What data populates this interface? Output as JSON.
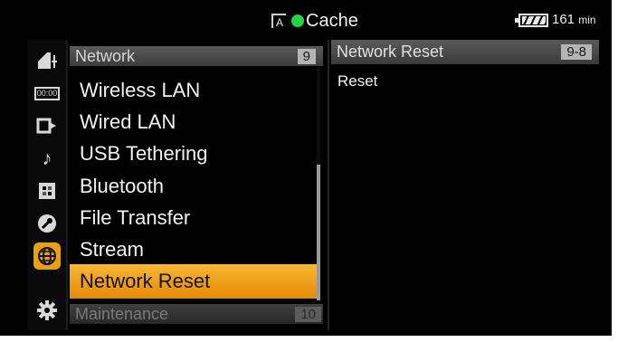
{
  "status_bar": {
    "media_icon_glyph": "A",
    "media_label": "Cache",
    "recording_dot_color": "#25d23f",
    "battery_icon": "battery-icon",
    "battery_level": 0.85,
    "battery_minutes": "161",
    "battery_unit": "min"
  },
  "category_icons": [
    {
      "name": "camera-icon",
      "glyph": "◢",
      "selected": false
    },
    {
      "name": "timecode-icon",
      "glyph": "00:00",
      "selected": false
    },
    {
      "name": "output-icon",
      "glyph": "⇥",
      "selected": false
    },
    {
      "name": "audio-icon",
      "glyph": "♪",
      "selected": false
    },
    {
      "name": "thumbnail-icon",
      "glyph": "▦",
      "selected": false
    },
    {
      "name": "tool-icon",
      "glyph": "⚙",
      "selected": false
    },
    {
      "name": "network-icon",
      "glyph": "⊕",
      "selected": true
    },
    {
      "name": "maintenance-icon",
      "glyph": "✹",
      "selected": false
    }
  ],
  "menu": {
    "header_title": "Network",
    "header_page": "9",
    "items": [
      "Wireless LAN",
      "Wired LAN",
      "USB Tethering",
      "Bluetooth",
      "File Transfer",
      "Stream",
      "Network Reset"
    ],
    "selected_index": 6,
    "footer_title": "Maintenance",
    "footer_page": "10"
  },
  "detail": {
    "header_title": "Network Reset",
    "header_page": "9-8",
    "options": [
      "Reset"
    ]
  },
  "colors": {
    "selection": "#f2a21e",
    "header_gray": "#4a4a4a",
    "background": "#000000"
  }
}
